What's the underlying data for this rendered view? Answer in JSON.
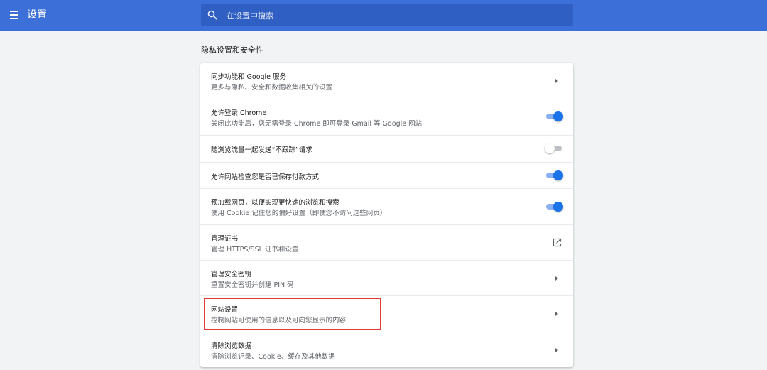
{
  "header": {
    "title": "设置",
    "menu_icon": "hamburger-menu-icon",
    "search": {
      "placeholder": "在设置中搜索",
      "value": "",
      "icon": "search-icon"
    }
  },
  "section": {
    "title": "隐私设置和安全性"
  },
  "rows": [
    {
      "title": "同步功能和 Google 服务",
      "subtitle": "更多与隐私、安全和数据收集相关的设置",
      "control": "chevron"
    },
    {
      "title": "允许登录 Chrome",
      "subtitle": "关闭此功能后，您无需登录 Chrome 即可登录 Gmail 等 Google 网站",
      "control": "toggle",
      "on": true
    },
    {
      "title": "随浏览流量一起发送“不跟踪”请求",
      "subtitle": "",
      "control": "toggle",
      "on": false
    },
    {
      "title": "允许网站检查您是否已保存付款方式",
      "subtitle": "",
      "control": "toggle",
      "on": true
    },
    {
      "title": "预加载网页，以便实现更快速的浏览和搜索",
      "subtitle": "使用 Cookie 记住您的偏好设置（即使您不访问这些网页）",
      "control": "toggle",
      "on": true
    },
    {
      "title": "管理证书",
      "subtitle": "管理 HTTPS/SSL 证书和设置",
      "control": "external"
    },
    {
      "title": "管理安全密钥",
      "subtitle": "重置安全密钥并创建 PIN 码",
      "control": "chevron"
    },
    {
      "title": "网站设置",
      "subtitle": "控制网站可使用的信息以及可向您显示的内容",
      "control": "chevron"
    },
    {
      "title": "清除浏览数据",
      "subtitle": "清除浏览记录、Cookie、缓存及其他数据",
      "control": "chevron"
    }
  ],
  "colors": {
    "header_bg": "#3c6fd8",
    "accent": "#1a73e8",
    "highlight_box": "#e53935"
  }
}
